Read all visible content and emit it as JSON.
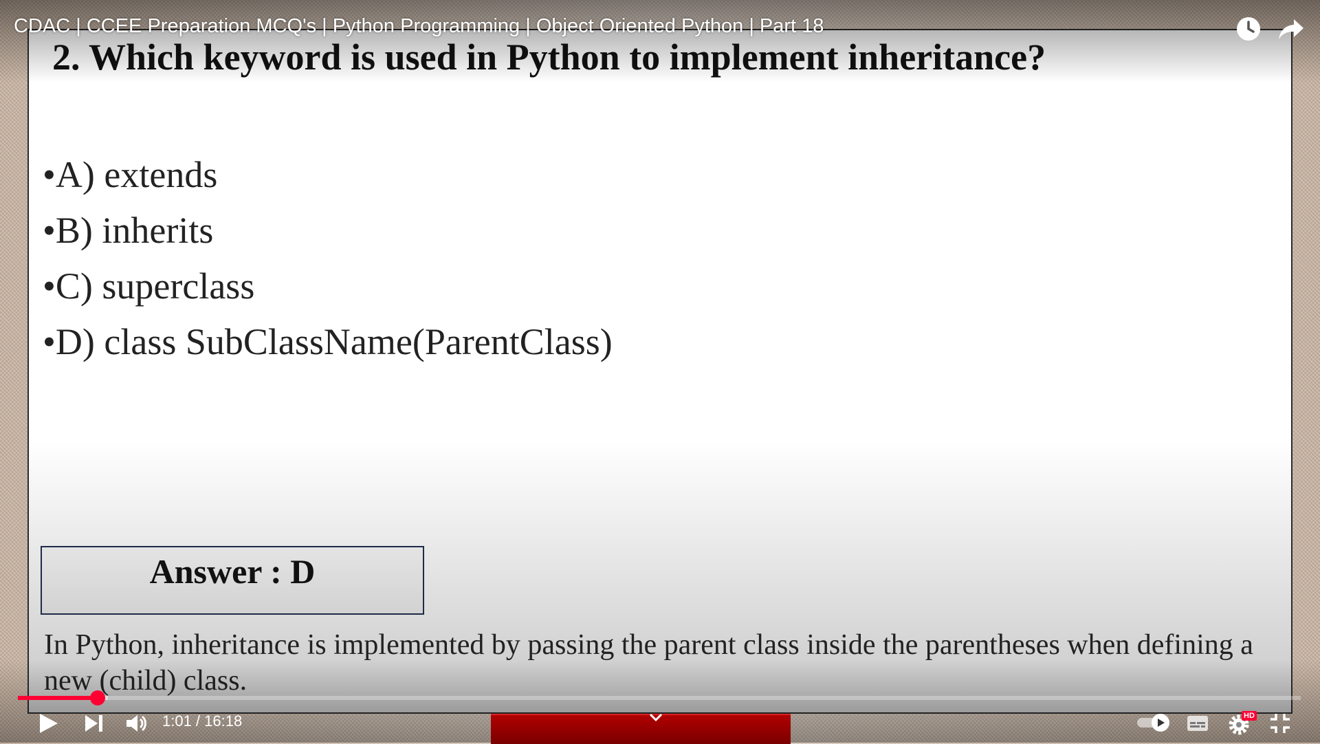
{
  "player": {
    "video_title": "CDAC | CCEE Preparation MCQ's | Python Programming | Object Oriented Python | Part 18",
    "current_time": "1:01",
    "duration": "16:18",
    "time_display": "1:01 / 16:18",
    "progress_fraction": 0.0624,
    "buffered_fraction": 0.07,
    "hd_badge": "HD",
    "accent_color": "#ff0033"
  },
  "slide": {
    "question": "2. Which keyword is used in Python to implement inheritance?",
    "options": [
      {
        "bullet": "•",
        "text": "A) extends"
      },
      {
        "bullet": "•",
        "text": "B) inherits"
      },
      {
        "bullet": "•",
        "text": "C) superclass"
      },
      {
        "bullet": "•",
        "text": "D) class SubClassName(ParentClass)"
      }
    ],
    "answer": "Answer : D",
    "explanation": "In Python, inheritance is implemented by passing the parent class inside the parentheses when defining a new (child) class."
  },
  "icons": {
    "watch_later": "clock-icon",
    "share": "share-arrow-icon",
    "play": "play-icon",
    "next": "next-icon",
    "volume": "volume-icon",
    "autoplay": "autoplay-toggle-icon",
    "subtitles": "subtitles-icon",
    "settings": "gear-icon",
    "exit_fullscreen": "exit-fullscreen-icon"
  }
}
